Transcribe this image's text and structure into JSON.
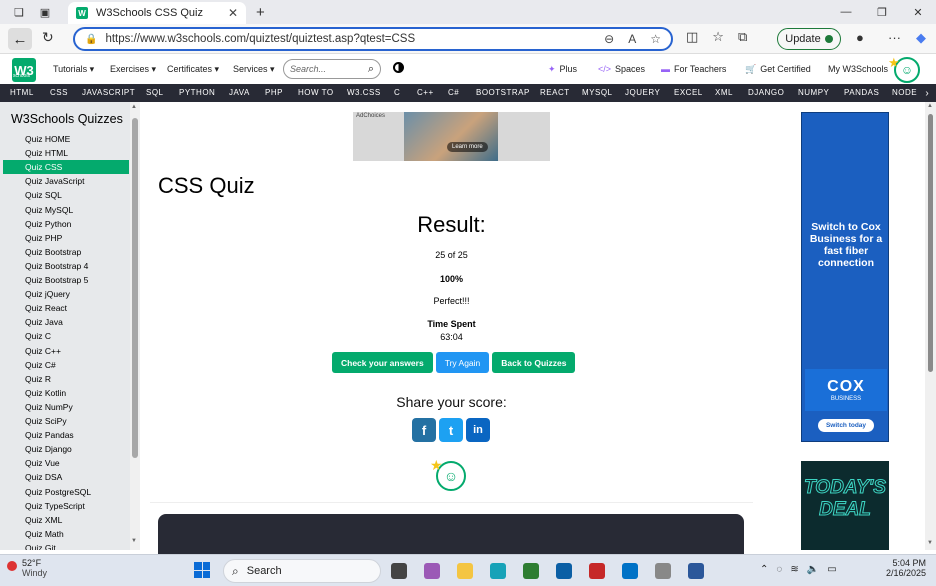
{
  "browser": {
    "tab_title": "W3Schools CSS Quiz",
    "tab_favicon": "W",
    "url": "https://www.w3schools.com/quiztest/quiztest.asp?qtest=CSS",
    "update_label": "Update"
  },
  "w3nav": {
    "logo": "W3",
    "logo_sub": "schools",
    "menu": [
      "Tutorials ▾",
      "Exercises ▾",
      "Certificates ▾",
      "Services ▾"
    ],
    "search_placeholder": "Search...",
    "right_links": [
      "Plus",
      "Spaces",
      "For Teachers",
      "Get Certified",
      "My W3Schools"
    ]
  },
  "topics": [
    "HTML",
    "CSS",
    "JAVASCRIPT",
    "SQL",
    "PYTHON",
    "JAVA",
    "PHP",
    "HOW TO",
    "W3.CSS",
    "C",
    "C++",
    "C#",
    "BOOTSTRAP",
    "REACT",
    "MYSQL",
    "JQUERY",
    "EXCEL",
    "XML",
    "DJANGO",
    "NUMPY",
    "PANDAS",
    "NODE"
  ],
  "sidebar": {
    "title": "W3Schools Quizzes",
    "items": [
      "Quiz HOME",
      "Quiz HTML",
      "Quiz CSS",
      "Quiz JavaScript",
      "Quiz SQL",
      "Quiz MySQL",
      "Quiz Python",
      "Quiz PHP",
      "Quiz Bootstrap",
      "Quiz Bootstrap 4",
      "Quiz Bootstrap 5",
      "Quiz jQuery",
      "Quiz React",
      "Quiz Java",
      "Quiz C",
      "Quiz C++",
      "Quiz C#",
      "Quiz R",
      "Quiz Kotlin",
      "Quiz NumPy",
      "Quiz SciPy",
      "Quiz Pandas",
      "Quiz Django",
      "Quiz Vue",
      "Quiz DSA",
      "Quiz PostgreSQL",
      "Quiz TypeScript",
      "Quiz XML",
      "Quiz Math",
      "Quiz Git"
    ],
    "active": "Quiz CSS"
  },
  "ad_top": {
    "adchoices": "AdChoices",
    "cta": "Learn more"
  },
  "main": {
    "title": "CSS Quiz",
    "result_heading": "Result:",
    "score": "25 of 25",
    "percent": "100%",
    "message": "Perfect!!!",
    "time_label": "Time Spent",
    "time_value": "63:04",
    "buttons": {
      "check": "Check your answers",
      "try_again": "Try Again",
      "back": "Back to Quizzes"
    },
    "share_heading": "Share your score:"
  },
  "ad_right": {
    "text": "Switch to Cox Business for a fast fiber connection",
    "brand": "COX",
    "brand_sub": "BUSINESS",
    "cta": "Switch today",
    "deal": "TODAY'S DEAL"
  },
  "taskbar": {
    "temp": "52°F",
    "weather": "Windy",
    "search": "Search",
    "time": "5:04 PM",
    "date": "2/16/2025"
  },
  "colors": {
    "w3_green": "#04aa6d",
    "w3_dark": "#282a35",
    "blue_btn": "#2196f3"
  }
}
